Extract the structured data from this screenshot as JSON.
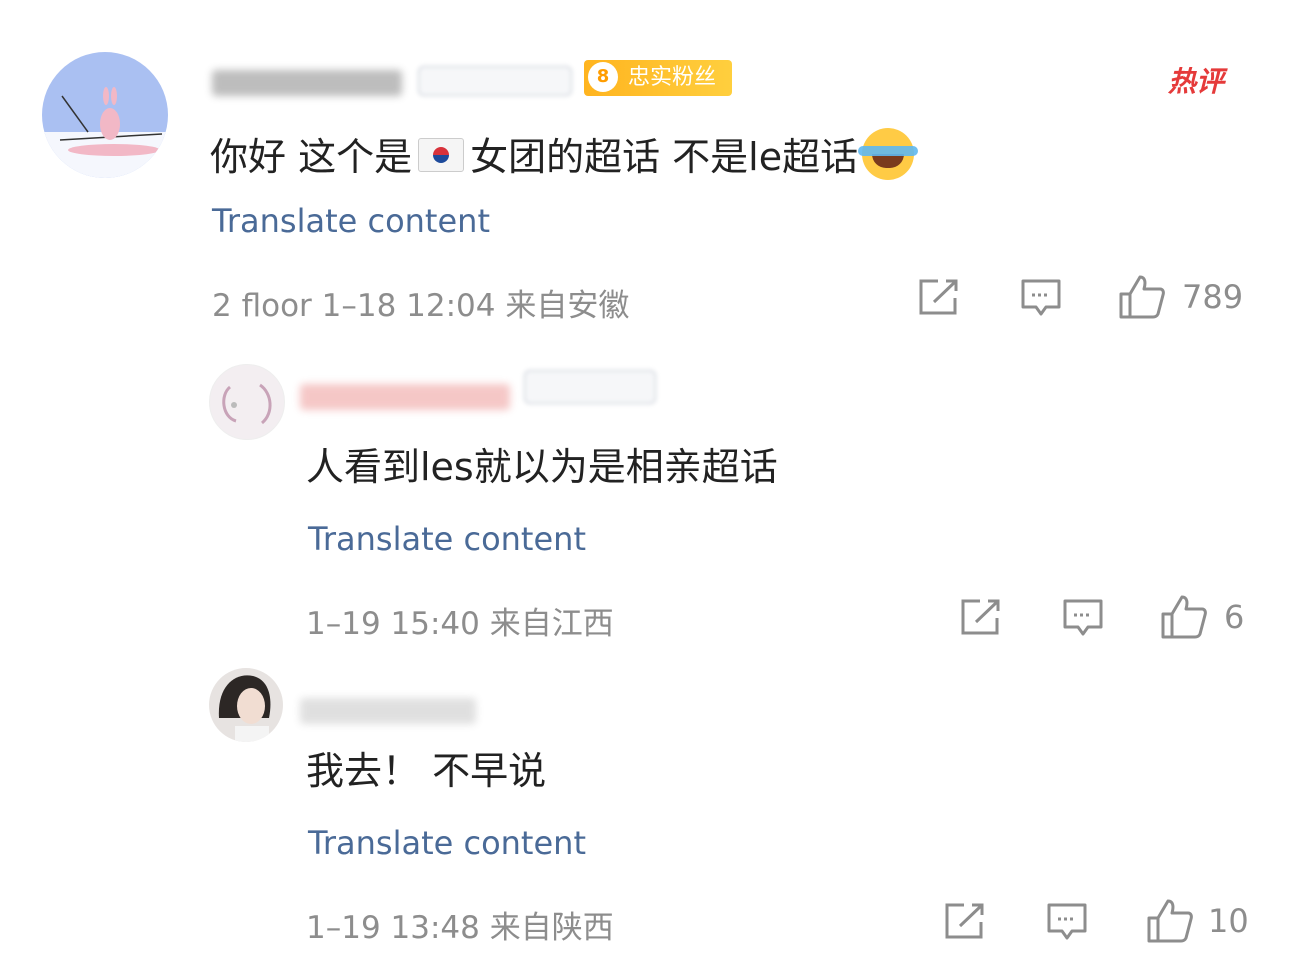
{
  "hot_label": "热评",
  "main_comment": {
    "badge": {
      "level": "8",
      "label": "忠实粉丝"
    },
    "text_before_flag": "你好 这个是",
    "text_after_flag": "女团的超话 不是le超话",
    "translate": "Translate content",
    "meta": "2 floor 1–18 12:04 来自安徽",
    "likes": "789",
    "flag_icon": "south-korea-flag-icon",
    "emoji_icon": "tears-of-joy-emoji-icon"
  },
  "replies": [
    {
      "text": "人看到les就以为是相亲超话",
      "translate": "Translate content",
      "meta": "1–19 15:40 来自江西",
      "likes": "6"
    },
    {
      "text": "我去！ 不早说",
      "translate": "Translate content",
      "meta": "1–19 13:48 来自陕西",
      "likes": "10"
    }
  ],
  "colors": {
    "link": "#4a6a97",
    "meta": "#8d8d8d",
    "badge": "#ffb41f",
    "hot": "#e53a3a"
  }
}
